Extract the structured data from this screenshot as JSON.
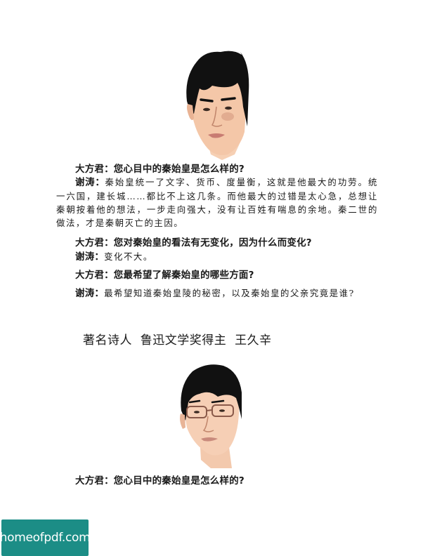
{
  "interview1": {
    "q1": "大方君：您心目中的秦始皇是怎么样的?",
    "a1_speaker": "谢涛：",
    "a1_text": "秦始皇统一了文字、货币、度量衡，这就是他最大的功劳。统一六国，建长城……都比不上这几条。而他最大的过错是太心急，总想让秦朝按着他的想法，一步走向强大，没有让百姓有喘息的余地。秦二世的做法，才是秦朝灭亡的主因。",
    "q2": "大方君：您对秦始皇的看法有无变化，因为什么而变化?",
    "a2_speaker": "谢涛：",
    "a2_text": "变化不大。",
    "q3": "大方君：您最希望了解秦始皇的哪些方面?",
    "a3_speaker": "谢涛：",
    "a3_text": "最希望知道秦始皇陵的秘密，以及秦始皇的父亲究竟是谁?"
  },
  "interview2": {
    "heading": "著名诗人  鲁迅文学奖得主  王久辛",
    "q1": "大方君：您心目中的秦始皇是怎么样的?"
  },
  "footer": {
    "logo_text": "homeofpdf.com",
    "logo_color": "#1c8d86"
  }
}
